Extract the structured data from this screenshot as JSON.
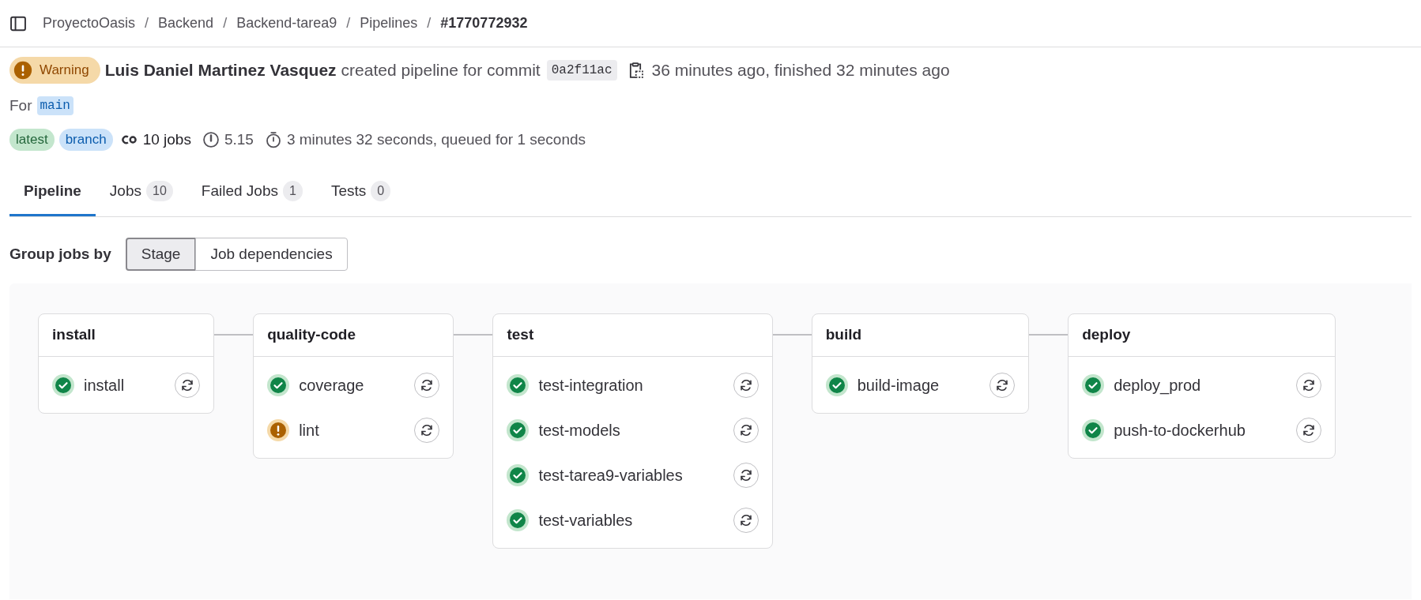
{
  "breadcrumb": [
    {
      "label": "ProyectoOasis",
      "current": false
    },
    {
      "separator": "/",
      "label": "Backend",
      "current": false
    },
    {
      "separator": "/",
      "label": "Backend-tarea9",
      "current": false
    },
    {
      "separator": "/",
      "label": "Pipelines",
      "current": false
    },
    {
      "separator": "/",
      "label": "#1770772932",
      "current": true
    }
  ],
  "header": {
    "status": {
      "kind": "warning",
      "label": "Warning"
    },
    "author": "Luis Daniel Martinez Vasquez",
    "action": "created pipeline for commit",
    "commit": "0a2f11ac",
    "times": "36 minutes ago, finished 32 minutes ago",
    "ref_prefix": "For",
    "ref": "main",
    "badges": [
      {
        "label": "latest",
        "kind": "green"
      },
      {
        "label": "branch",
        "kind": "blue"
      }
    ],
    "jobs": "10 jobs",
    "score": "5.15",
    "duration": "3 minutes 32 seconds, queued for 1 seconds"
  },
  "tabs": [
    {
      "label": "Pipeline",
      "selected": true
    },
    {
      "label": "Jobs",
      "count": "10",
      "selected": false
    },
    {
      "label": "Failed Jobs",
      "count": "1",
      "selected": false
    },
    {
      "label": "Tests",
      "count": "0",
      "selected": false
    }
  ],
  "group_by": {
    "label": "Group jobs by",
    "options": [
      {
        "label": "Stage",
        "selected": true
      },
      {
        "label": "Job dependencies",
        "selected": false
      }
    ]
  },
  "stages": [
    {
      "name": "install",
      "jobs": [
        {
          "name": "install",
          "kind": "success"
        }
      ]
    },
    {
      "name": "quality-code",
      "jobs": [
        {
          "name": "coverage",
          "kind": "success"
        },
        {
          "name": "lint",
          "kind": "warning"
        }
      ]
    },
    {
      "name": "test",
      "jobs": [
        {
          "name": "test-integration",
          "kind": "success"
        },
        {
          "name": "test-models",
          "kind": "success"
        },
        {
          "name": "test-tarea9-variables",
          "kind": "success"
        },
        {
          "name": "test-variables",
          "kind": "success"
        }
      ]
    },
    {
      "name": "build",
      "jobs": [
        {
          "name": "build-image",
          "kind": "success"
        }
      ]
    },
    {
      "name": "deploy",
      "jobs": [
        {
          "name": "deploy_prod",
          "kind": "success"
        },
        {
          "name": "push-to-dockerhub",
          "kind": "success"
        }
      ]
    }
  ]
}
